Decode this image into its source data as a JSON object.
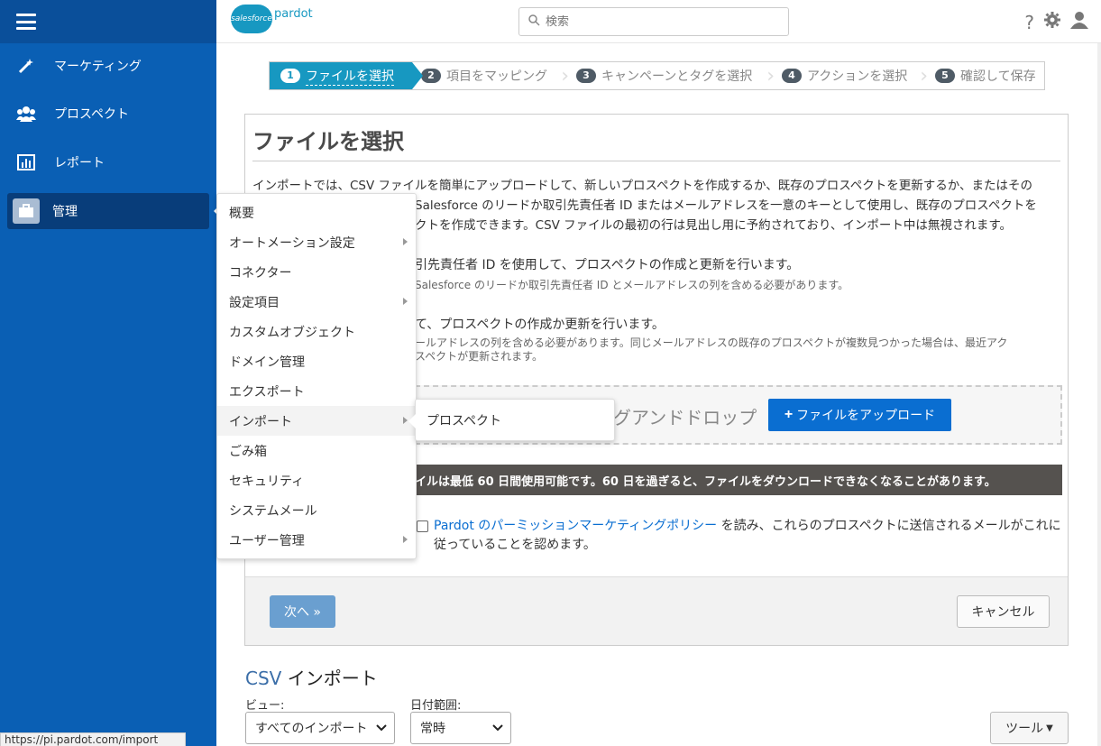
{
  "sidebar": {
    "items": [
      {
        "label": "マーケティング",
        "icon": "wand-icon"
      },
      {
        "label": "プロスペクト",
        "icon": "people-icon"
      },
      {
        "label": "レポート",
        "icon": "chart-icon"
      },
      {
        "label": "管理",
        "icon": "briefcase-icon"
      }
    ]
  },
  "topbar": {
    "logo_cloud": "salesforce",
    "logo_text": "pardot",
    "search_placeholder": "検索"
  },
  "wizard": {
    "steps": [
      {
        "num": "1",
        "label": "ファイルを選択"
      },
      {
        "num": "2",
        "label": "項目をマッピング"
      },
      {
        "num": "3",
        "label": "キャンペーンとタグを選択"
      },
      {
        "num": "4",
        "label": "アクションを選択"
      },
      {
        "num": "5",
        "label": "確認して保存"
      }
    ]
  },
  "panel": {
    "title": "ファイルを選択",
    "intro_line1": "インポートでは、CSV ファイルを簡単にアップロードして、新しいプロスペクトを作成するか、既存のプロスペクトを更新するか、またはその",
    "intro_line2": "Salesforce のリードか取引先責任者 ID またはメールアドレスを一意のキーとして使用し、既存のプロスペクトを",
    "intro_line3": "クトを作成できます。CSV ファイルの最初の行は見出し用に予約されており、インポート中は無視されます。",
    "option1": "引先責任者 ID を使用して、プロスペクトの作成と更新を行います。",
    "option1_sub": "Salesforce のリードか取引先責任者 ID とメールアドレスの列を含める必要があります。",
    "option2": "て、プロスペクトの作成か更新を行います。",
    "option2_sub1": "ールアドレスの列を含める必要があります。同じメールアドレスの既存のプロスペクトが複数見つかった場合は、最近アク",
    "option2_sub2": "スペクトが更新されます。",
    "dropzone_text": "グアンドドロップ",
    "upload_button": "ファイルをアップロード",
    "warning": "イルは最低 60 日間使用可能です。60 日を過ぎると、ファイルをダウンロードできなくなることがあります。",
    "consent_link": "Pardot のパーミッションマーケティングポリシー",
    "consent_text": " を読み、これらのプロスペクトに送信されるメールがこれに従っていることを認めます。",
    "next_button": "次へ »",
    "cancel_button": "キャンセル"
  },
  "csv": {
    "title_prefix": "CSV ",
    "title_main": "インポート",
    "view_label": "ビュー:",
    "view_value": "すべてのインポート",
    "date_label": "日付範囲:",
    "date_value": "常時",
    "tools_button": "ツール"
  },
  "menu": {
    "items": [
      {
        "label": "概要",
        "has_sub": false
      },
      {
        "label": "オートメーション設定",
        "has_sub": true
      },
      {
        "label": "コネクター",
        "has_sub": false
      },
      {
        "label": "設定項目",
        "has_sub": true
      },
      {
        "label": "カスタムオブジェクト",
        "has_sub": false
      },
      {
        "label": "ドメイン管理",
        "has_sub": false
      },
      {
        "label": "エクスポート",
        "has_sub": false
      },
      {
        "label": "インポート",
        "has_sub": true
      },
      {
        "label": "ごみ箱",
        "has_sub": false
      },
      {
        "label": "セキュリティ",
        "has_sub": false
      },
      {
        "label": "システムメール",
        "has_sub": false
      },
      {
        "label": "ユーザー管理",
        "has_sub": true
      }
    ],
    "submenu_item": "プロスペクト"
  },
  "status_url": "https://pi.pardot.com/import",
  "colors": {
    "sidebar": "#0a5fb4",
    "accent": "#1798c1",
    "primary_button": "#0a6ed1"
  }
}
